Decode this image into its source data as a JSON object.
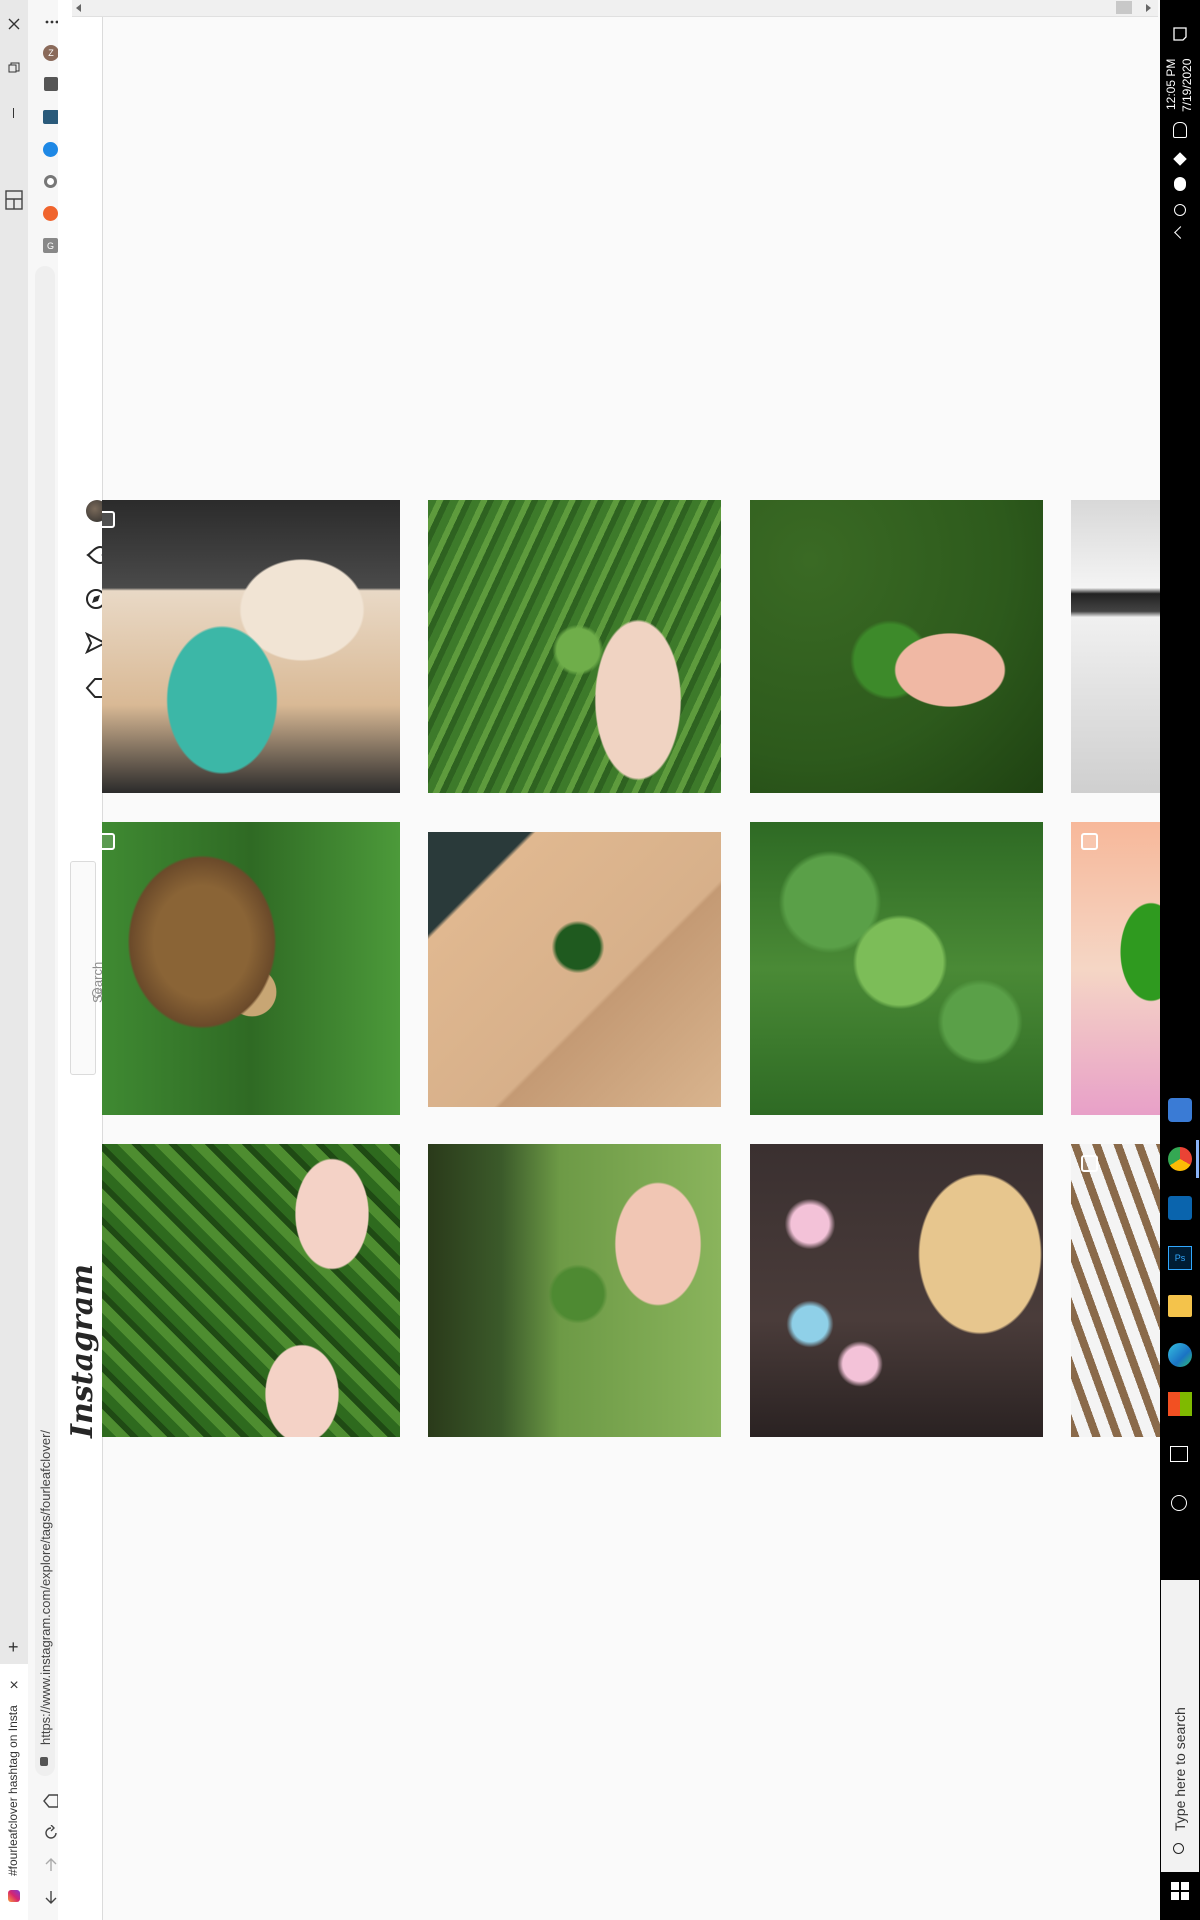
{
  "browser": {
    "tab_title": "#fourleafclover hashtag on Insta",
    "url": "https://www.instagram.com/explore/tags/fourleafclover/",
    "new_tab_label": "+",
    "close_tab_label": "×"
  },
  "instagram": {
    "logo_text": "Instagram",
    "search_placeholder": "Search"
  },
  "taskbar": {
    "time": "12:05 PM",
    "date": "7/19/2020",
    "search_placeholder": "Type here to search"
  },
  "colors": {
    "taskbar_bg": "#000000",
    "page_bg": "#fafafa",
    "sidebar_bg": "#f3f3f3"
  },
  "grid": {
    "images": [
      {
        "name": "dog-sleeping",
        "colors": [
          "#e9d9c6",
          "#3cb7a7",
          "#2b2b2b"
        ]
      },
      {
        "name": "clover-fingers-grass",
        "colors": [
          "#3d7a2a",
          "#e8c8b6",
          "#5e9b3d"
        ]
      },
      {
        "name": "four-leaf-clover-fingers",
        "colors": [
          "#2d5a1c",
          "#f0b8a4",
          "#4a7d2a"
        ]
      },
      {
        "name": "partial-image-1",
        "colors": [
          "#d8d8d8",
          "#222222",
          "#f4f4f4"
        ]
      },
      {
        "name": "tortoise-clover",
        "colors": [
          "#6b4a2a",
          "#3f8a32",
          "#c8a674"
        ]
      },
      {
        "name": "clover-on-cardboard",
        "colors": [
          "#d7b08a",
          "#1f5a1f",
          "#2a3a3a"
        ]
      },
      {
        "name": "clover-patch",
        "colors": [
          "#5aa048",
          "#2e6a24",
          "#7cbd58"
        ]
      },
      {
        "name": "partial-image-2",
        "colors": [
          "#f7b89a",
          "#2f9a1f",
          "#f5d6c5"
        ]
      },
      {
        "name": "two-clovers-hands",
        "colors": [
          "#2e6a1e",
          "#f4d2c6",
          "#4e8d30"
        ]
      },
      {
        "name": "clover-blurred-grass",
        "colors": [
          "#6d9a46",
          "#f1c6b4",
          "#3b5a2a"
        ]
      },
      {
        "name": "clover-pins-bread",
        "colors": [
          "#3a3030",
          "#e7c68e",
          "#8fd0e8"
        ]
      },
      {
        "name": "partial-image-3",
        "colors": [
          "#8a6a4a",
          "#f4f4f4",
          "#2a2a2a"
        ]
      }
    ]
  }
}
